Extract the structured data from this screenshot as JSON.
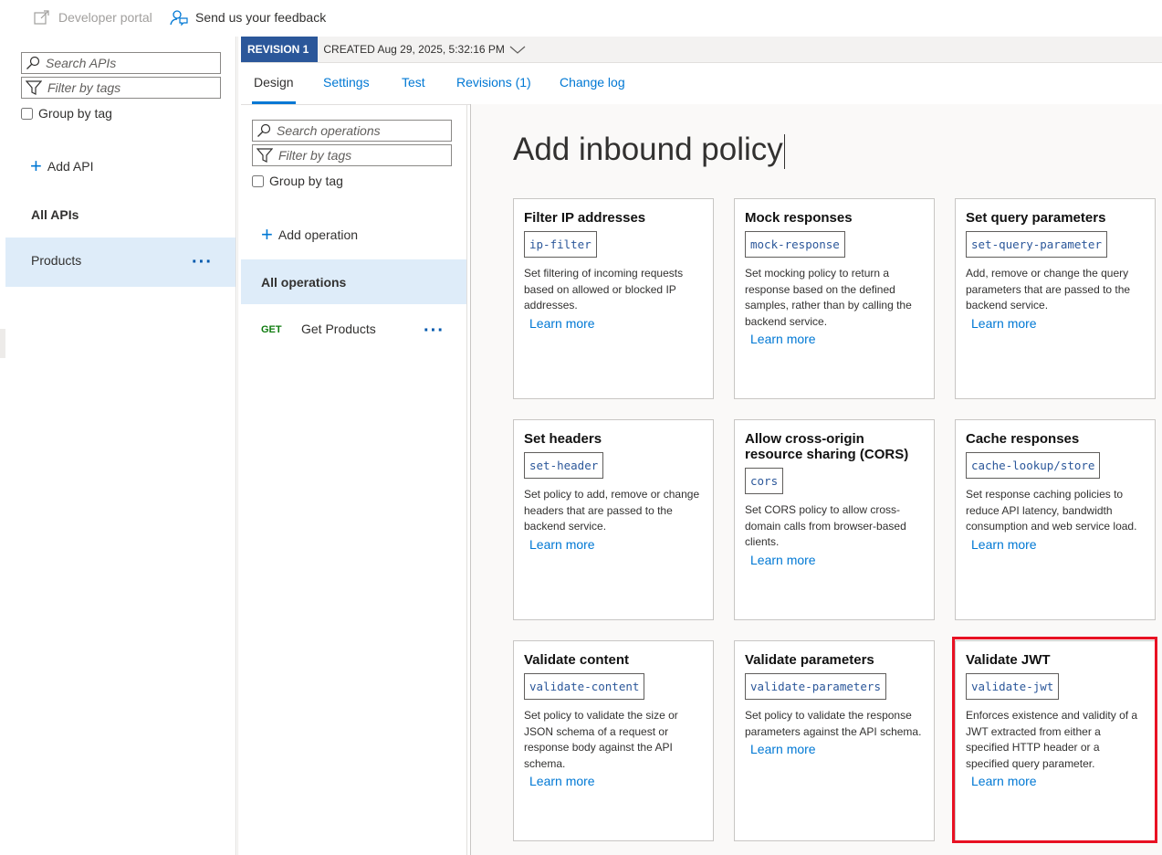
{
  "toolbar": {
    "developer_portal": "Developer portal",
    "feedback": "Send us your feedback"
  },
  "apis_panel": {
    "search_placeholder": "Search APIs",
    "filter_placeholder": "Filter by tags",
    "group_by_tag": "Group by tag",
    "add_api": "Add API",
    "all_apis": "All APIs",
    "items": [
      {
        "label": "Products",
        "more": "..."
      }
    ]
  },
  "revision": {
    "badge": "REVISION 1",
    "created": "CREATED Aug 29, 2025, 5:32:16 PM"
  },
  "tabs": [
    {
      "label": "Design"
    },
    {
      "label": "Settings"
    },
    {
      "label": "Test"
    },
    {
      "label": "Revisions (1)"
    },
    {
      "label": "Change log"
    }
  ],
  "operations_panel": {
    "search_placeholder": "Search operations",
    "filter_placeholder": "Filter by tags",
    "group_by_tag": "Group by tag",
    "add_operation": "Add operation",
    "all_operations": "All operations",
    "items": [
      {
        "method": "GET",
        "label": "Get Products",
        "more": "..."
      }
    ]
  },
  "main": {
    "heading": "Add inbound policy",
    "cards": [
      {
        "title": "Filter IP addresses",
        "code": "ip-filter",
        "desc": "Set filtering of incoming requests based on allowed or blocked IP addresses.",
        "link": "Learn more"
      },
      {
        "title": "Mock responses",
        "code": "mock-response",
        "desc": "Set mocking policy to return a response based on the defined samples, rather than by calling the backend service.",
        "link": "Learn more"
      },
      {
        "title": "Set query parameters",
        "code": "set-query-parameter",
        "desc": "Add, remove or change the query parameters that are passed to the backend service.",
        "link": "Learn more"
      },
      {
        "title": "Set headers",
        "code": "set-header",
        "desc": "Set policy to add, remove or change headers that are passed to the backend service.",
        "link": "Learn more"
      },
      {
        "title": "Allow cross-origin resource sharing (CORS)",
        "code": "cors",
        "desc": "Set CORS policy to allow cross-domain calls from browser-based clients.",
        "link": "Learn more"
      },
      {
        "title": "Cache responses",
        "code": "cache-lookup/store",
        "desc": "Set response caching policies to reduce API latency, bandwidth consumption and web service load.",
        "link": "Learn more"
      },
      {
        "title": "Validate content",
        "code": "validate-content",
        "desc": "Set policy to validate the size or JSON schema of a request or response body against the API schema.",
        "link": "Learn more"
      },
      {
        "title": "Validate parameters",
        "code": "validate-parameters",
        "desc": "Set policy to validate the response parameters against the API schema.",
        "link": "Learn more"
      },
      {
        "title": "Validate JWT",
        "code": "validate-jwt",
        "desc": "Enforces existence and validity of a JWT extracted from either a specified HTTP header or a specified query parameter.",
        "link": "Learn more"
      }
    ]
  },
  "colors": {
    "accent": "#0078d4",
    "revision_badge": "#2b579a",
    "highlight": "#e81123",
    "selected_row": "#deecf9",
    "get_method": "#107c10"
  }
}
